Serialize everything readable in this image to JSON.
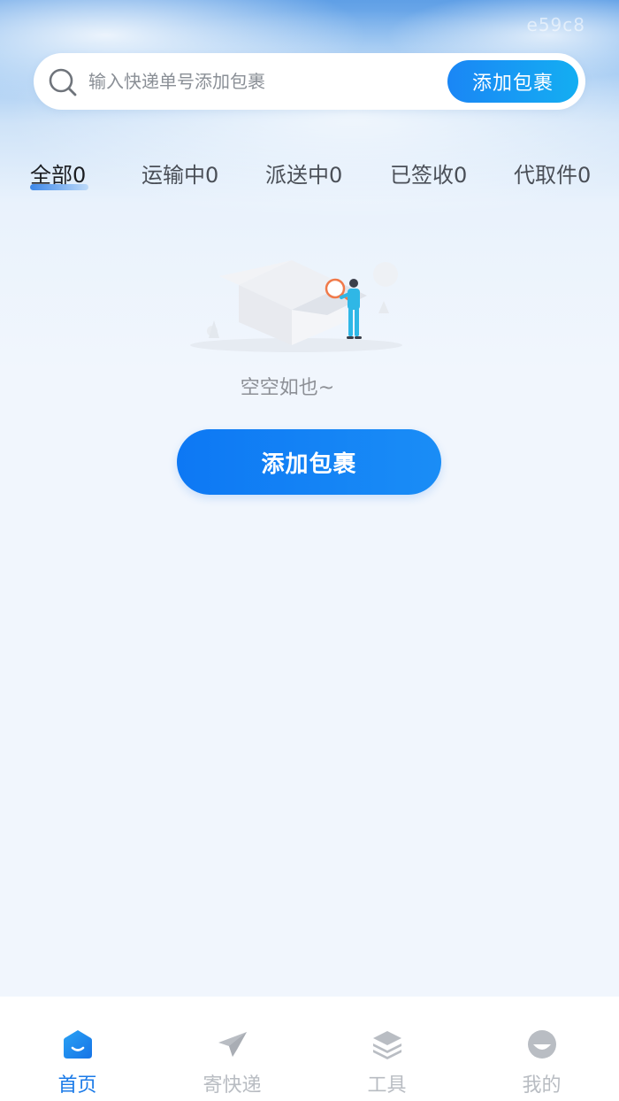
{
  "watermark": "e59c8",
  "search": {
    "placeholder": "输入快递单号添加包裹",
    "button_label": "添加包裹"
  },
  "tabs": [
    {
      "label": "全部0",
      "active": true
    },
    {
      "label": "运输中0",
      "active": false
    },
    {
      "label": "派送中0",
      "active": false
    },
    {
      "label": "已签收0",
      "active": false
    },
    {
      "label": "代取件0",
      "active": false
    }
  ],
  "empty_state": {
    "message": "空空如也~",
    "button_label": "添加包裹"
  },
  "bottom_nav": [
    {
      "label": "首页",
      "icon": "home-icon",
      "active": true
    },
    {
      "label": "寄快递",
      "icon": "paper-plane-icon",
      "active": false
    },
    {
      "label": "工具",
      "icon": "layers-icon",
      "active": false
    },
    {
      "label": "我的",
      "icon": "profile-icon",
      "active": false
    }
  ],
  "colors": {
    "accent": "#1a7ae8",
    "button_gradient_start": "#0d78f4",
    "button_gradient_end": "#1a8df6",
    "inactive_nav": "#b8bcc2"
  }
}
